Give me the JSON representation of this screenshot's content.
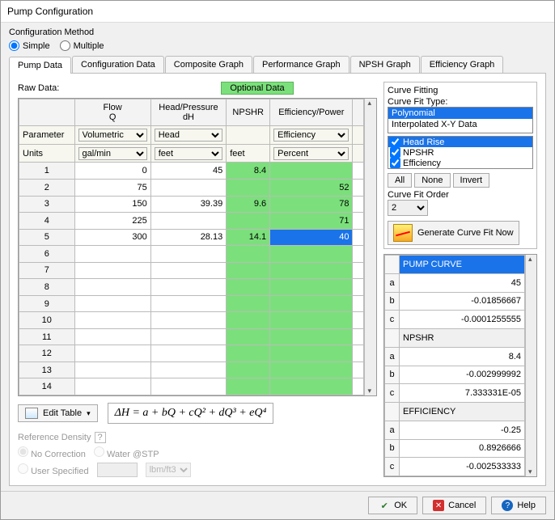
{
  "window_title": "Pump Configuration",
  "config_method": {
    "legend": "Configuration Method",
    "options": {
      "simple": "Simple",
      "multiple": "Multiple"
    },
    "selected": "simple"
  },
  "tabs": [
    "Pump Data",
    "Configuration Data",
    "Composite Graph",
    "Performance Graph",
    "NPSH Graph",
    "Efficiency Graph"
  ],
  "active_tab": 0,
  "raw_data_label": "Raw Data:",
  "optional_label": "Optional Data",
  "columns": {
    "flow": {
      "header1": "Flow",
      "header2": "Q",
      "param": "Volumetric",
      "units": "gal/min"
    },
    "head": {
      "header1": "Head/Pressure",
      "header2": "dH",
      "param": "Head",
      "units": "feet"
    },
    "npshr": {
      "header": "NPSHR",
      "units": "feet"
    },
    "eff": {
      "header": "Efficiency/Power",
      "param": "Efficiency",
      "units": "Percent"
    }
  },
  "param_label": "Parameter",
  "units_label": "Units",
  "rows": [
    {
      "n": 1,
      "flow": "0",
      "head": "45",
      "npshr": "8.4",
      "eff": ""
    },
    {
      "n": 2,
      "flow": "75",
      "head": "",
      "npshr": "",
      "eff": "52"
    },
    {
      "n": 3,
      "flow": "150",
      "head": "39.39",
      "npshr": "9.6",
      "eff": "78"
    },
    {
      "n": 4,
      "flow": "225",
      "head": "",
      "npshr": "",
      "eff": "71"
    },
    {
      "n": 5,
      "flow": "300",
      "head": "28.13",
      "npshr": "14.1",
      "eff": "40"
    },
    {
      "n": 6
    },
    {
      "n": 7
    },
    {
      "n": 8
    },
    {
      "n": 9
    },
    {
      "n": 10
    },
    {
      "n": 11
    },
    {
      "n": 12
    },
    {
      "n": 13
    },
    {
      "n": 14
    }
  ],
  "edit_table_label": "Edit Table",
  "formula_text": "ΔH = a + bQ + cQ² + dQ³ + eQ⁴",
  "ref_density": {
    "title": "Reference Density",
    "no_correction": "No Correction",
    "water_stp": "Water @STP",
    "user_specified": "User Specified",
    "units": "lbm/ft3"
  },
  "curve_fitting": {
    "title": "Curve Fitting",
    "type_label": "Curve Fit Type:",
    "types": [
      "Polynomial",
      "Interpolated X-Y Data"
    ],
    "selected_type": 0,
    "series": [
      {
        "label": "Head Rise",
        "checked": true,
        "sel": true
      },
      {
        "label": "NPSHR",
        "checked": true,
        "sel": false
      },
      {
        "label": "Efficiency",
        "checked": true,
        "sel": false
      }
    ],
    "buttons": {
      "all": "All",
      "none": "None",
      "invert": "Invert"
    },
    "order_label": "Curve Fit Order",
    "order_value": "2",
    "generate_label": "Generate Curve Fit Now"
  },
  "coefficients": [
    {
      "section": "PUMP CURVE",
      "rows": [
        [
          "a",
          "45"
        ],
        [
          "b",
          "-0.01856667"
        ],
        [
          "c",
          "-0.0001255555"
        ]
      ]
    },
    {
      "section": "NPSHR",
      "rows": [
        [
          "a",
          "8.4"
        ],
        [
          "b",
          "-0.002999992"
        ],
        [
          "c",
          "7.333331E-05"
        ]
      ]
    },
    {
      "section": "EFFICIENCY",
      "rows": [
        [
          "a",
          "-0.25"
        ],
        [
          "b",
          "0.8926666"
        ],
        [
          "c",
          "-0.002533333"
        ]
      ]
    }
  ],
  "bottom": {
    "ok": "OK",
    "cancel": "Cancel",
    "help": "Help"
  }
}
